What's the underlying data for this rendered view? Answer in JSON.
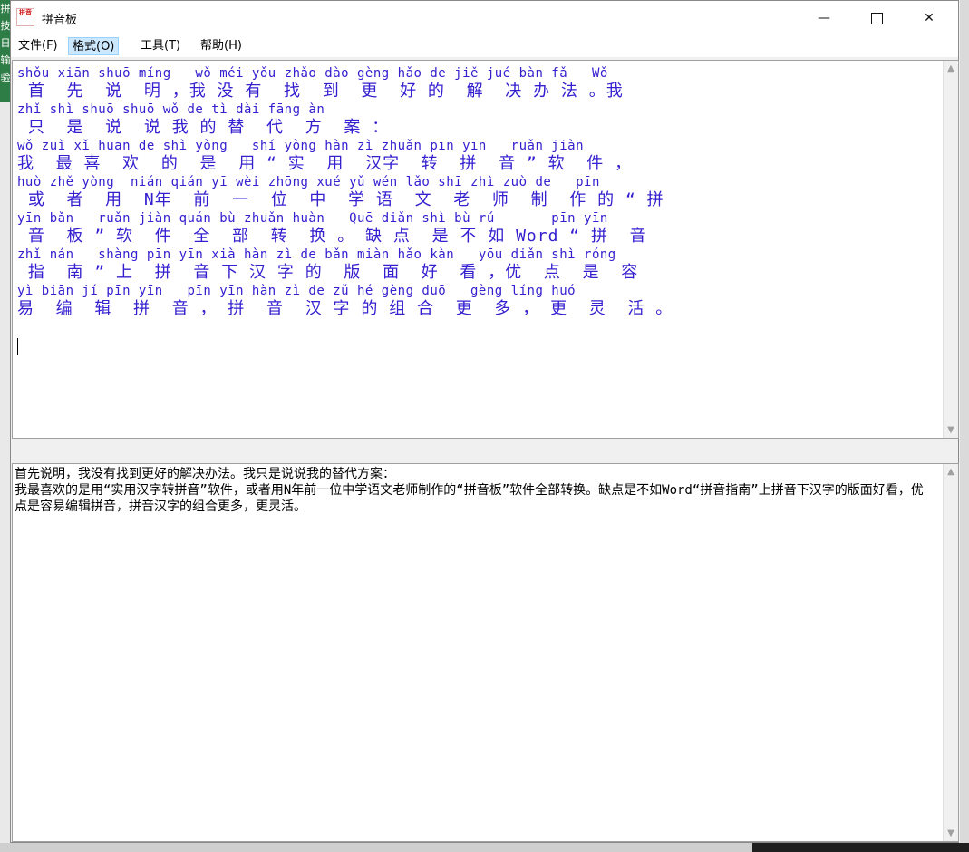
{
  "window": {
    "title": "拼音板",
    "icon_text": "拼音",
    "controls": {
      "minimize": "—",
      "close": "✕"
    }
  },
  "menu": [
    {
      "label": "文件(F)"
    },
    {
      "label": "格式(O)",
      "active": true
    },
    {
      "label": "工具(T)"
    },
    {
      "label": "帮助(H)"
    }
  ],
  "pinyin_view": {
    "lines": [
      {
        "pinyin": "shǒu xiān shuō míng   wǒ méi yǒu zhǎo dào gèng hǎo de jiě jué bàn fǎ   Wǒ",
        "hanzi": " 首  先  说  明 ，我 没 有  找  到  更  好 的  解  决 办 法 。我"
      },
      {
        "pinyin": "zhǐ shì shuō shuō wǒ de tì dài fāng àn",
        "hanzi": " 只  是  说  说 我 的 替  代  方  案 ："
      },
      {
        "pinyin": "wǒ zuì xǐ huan de shì yòng   shí yòng hàn zì zhuǎn pīn yīn   ruǎn jiàn",
        "hanzi": "我  最 喜  欢  的  是  用 “ 实  用  汉字  转  拼  音 ” 软  件 ，"
      },
      {
        "pinyin": "huò zhě yòng  nián qián yī wèi zhōng xué yǔ wén lǎo shī zhì zuò de   pīn",
        "hanzi": " 或  者  用  N年  前  一  位  中  学 语  文  老  师  制  作 的 “ 拼"
      },
      {
        "pinyin": "yīn bǎn   ruǎn jiàn quán bù zhuǎn huàn   Quē diǎn shì bù rú       pīn yīn",
        "hanzi": " 音  板 ” 软  件  全  部  转  换 。 缺 点  是 不 如 Word “ 拼  音"
      },
      {
        "pinyin": "zhǐ nán   shàng pīn yīn xià hàn zì de bǎn miàn hǎo kàn   yōu diǎn shì róng",
        "hanzi": " 指  南 ” 上  拼  音 下 汉 字 的  版  面  好  看 ，优  点  是  容"
      },
      {
        "pinyin": "yì biān jí pīn yīn   pīn yīn hàn zì de zǔ hé gèng duō   gèng líng huó",
        "hanzi": "易  编  辑  拼  音 ， 拼  音  汉 字 的 组 合  更  多 ， 更  灵  活 。"
      }
    ]
  },
  "source_text": "首先说明，我没有找到更好的解决办法。我只是说说我的替代方案：\n我最喜欢的是用“实用汉字转拼音”软件，或者用N年前一位中学语文老师制作的“拼音板”软件全部转换。缺点是不如Word“拼音指南”上拼音下汉字的版面好看，优点是容易编辑拼音，拼音汉字的组合更多，更灵活。",
  "background": {
    "left_sidebar_chars": [
      "拼",
      "技",
      "日",
      "输",
      "验"
    ]
  }
}
